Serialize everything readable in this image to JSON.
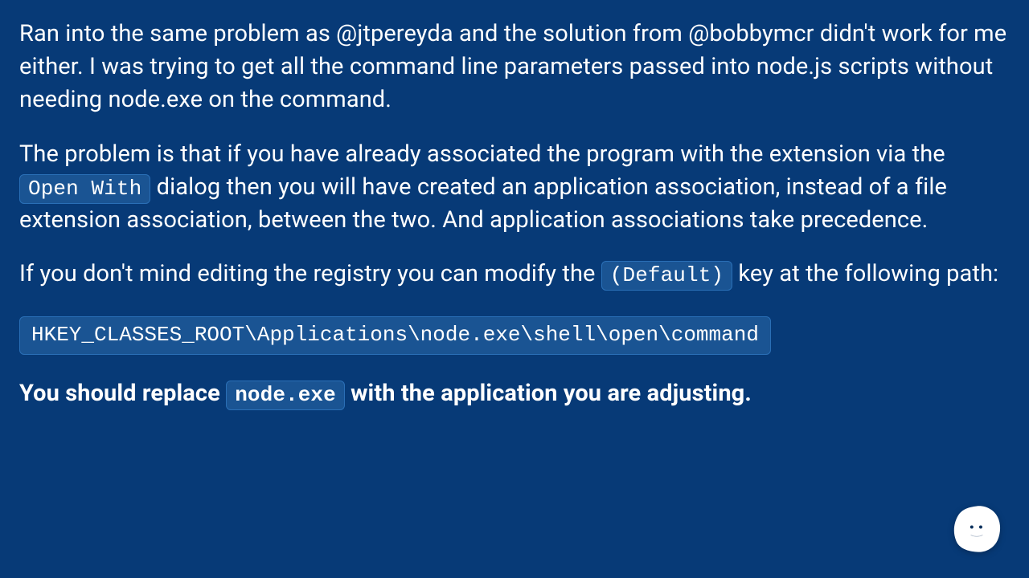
{
  "paragraphs": {
    "p1": "Ran into the same problem as @jtpereyda and the solution from @bobbymcr didn't work for me either. I was trying to get all the command line parameters passed into node.js scripts without needing node.exe on the command.",
    "p2_a": "The problem is that if you have already associated the program with the extension via the ",
    "p2_code": "Open With",
    "p2_b": " dialog then you will have created an application association, instead of a file extension association, between the two. And application associations take precedence.",
    "p3_a": "If you don't mind editing the registry you can modify the ",
    "p3_code": "(Default)",
    "p3_b": " key at the following path:",
    "codeblock": "HKEY_CLASSES_ROOT\\Applications\\node.exe\\shell\\open\\command",
    "p4_a": "You should replace ",
    "p4_code": "node.exe",
    "p4_b": " with the application you are adjusting."
  },
  "avatar": {
    "name": "cartoon-face-avatar"
  }
}
